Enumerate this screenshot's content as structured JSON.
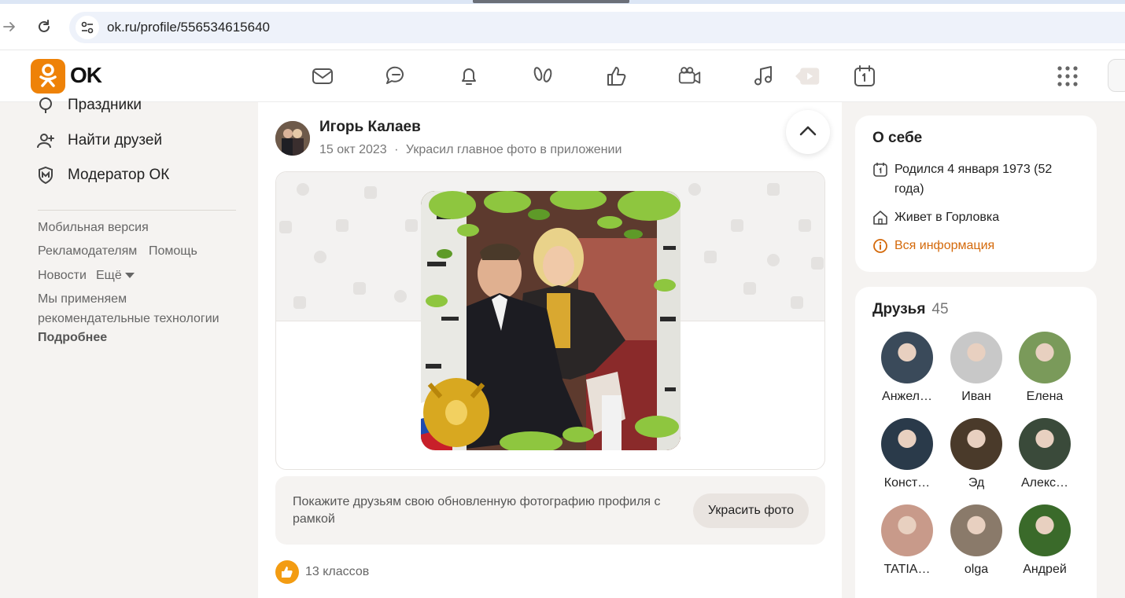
{
  "browser": {
    "url": "ok.ru/profile/556534615640"
  },
  "header": {
    "logo_text": "OK",
    "nav_icons": [
      "mail-icon",
      "chat-icon",
      "bell-icon",
      "guests-icon",
      "like-icon",
      "video-camera-icon",
      "music-icon",
      "video-play-icon",
      "calendar-icon"
    ],
    "apps_icon": "apps-grid-icon"
  },
  "sidebar": {
    "items": [
      {
        "label": "Праздники",
        "icon": "holidays-icon"
      },
      {
        "label": "Найти друзей",
        "icon": "add-friend-icon"
      },
      {
        "label": "Модератор ОК",
        "icon": "moderator-shield-icon"
      }
    ],
    "footer": {
      "mobile": "Мобильная версия",
      "advertisers": "Рекламодателям",
      "help": "Помощь",
      "news": "Новости",
      "more": "Ещё",
      "recommend_line1": "Мы применяем",
      "recommend_line2": "рекомендательные технологии",
      "details": "Подробнее"
    }
  },
  "post": {
    "author": "Игорь Калаев",
    "date": "15 окт 2023",
    "separator": "·",
    "action": "Украсил главное фото в приложении",
    "promo_text": "Покажите друзьям свою обновленную фотографию профиля с рамкой",
    "promo_button": "Украсить фото",
    "likes_text": "13 классов"
  },
  "about": {
    "title": "О себе",
    "born": "Родился 4 января 1973 (52 года)",
    "lives": "Живет в Горловка",
    "all_info": "Вся информация"
  },
  "friends": {
    "title": "Друзья",
    "count": "45",
    "list": [
      {
        "name": "Анжел…",
        "color": "#3a4a5a"
      },
      {
        "name": "Иван",
        "color": "#c8c8c8"
      },
      {
        "name": "Елена",
        "color": "#7a9a5a"
      },
      {
        "name": "Конст…",
        "color": "#2a3a4a"
      },
      {
        "name": "Эд",
        "color": "#4a3a2a"
      },
      {
        "name": "Алекс…",
        "color": "#3a4a3a"
      },
      {
        "name": "TATIA…",
        "color": "#c89a8a"
      },
      {
        "name": "olga",
        "color": "#8a7a6a"
      },
      {
        "name": "Андрей",
        "color": "#3a6a2a"
      }
    ]
  },
  "colors": {
    "accent": "#ee8208",
    "link": "#d4690a",
    "like": "#f39c12"
  }
}
